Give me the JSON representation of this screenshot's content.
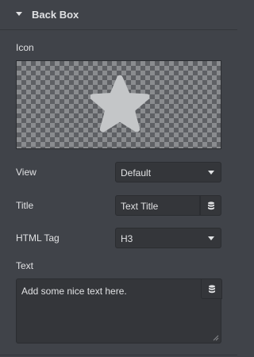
{
  "section": {
    "title": "Back Box"
  },
  "icon": {
    "label": "Icon",
    "preview_icon": "star-icon"
  },
  "view": {
    "label": "View",
    "value": "Default"
  },
  "title_field": {
    "label": "Title",
    "value": "Text Title",
    "dynamic_icon": "database-icon"
  },
  "html_tag": {
    "label": "HTML Tag",
    "value": "H3"
  },
  "text_field": {
    "label": "Text",
    "value": "Add some nice text here.",
    "dynamic_icon": "database-icon"
  },
  "colors": {
    "panel_bg": "#404349",
    "input_bg": "#34363a",
    "text": "#e0e1e3",
    "star": "#c4c6c8"
  }
}
